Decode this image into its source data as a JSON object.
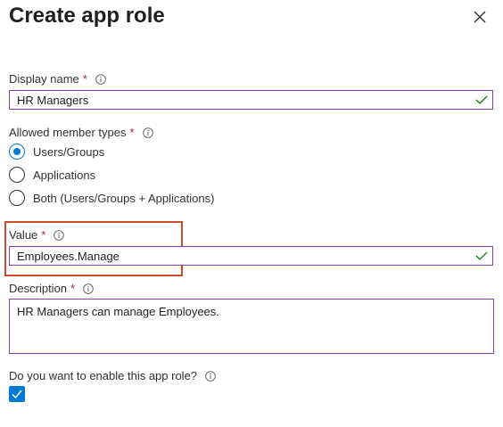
{
  "header": {
    "title": "Create app role"
  },
  "display_name": {
    "label": "Display name",
    "required_mark": "*",
    "value": "HR Managers"
  },
  "member_types": {
    "label": "Allowed member types",
    "required_mark": "*",
    "options": [
      "Users/Groups",
      "Applications",
      "Both (Users/Groups + Applications)"
    ],
    "selected": "Users/Groups"
  },
  "value_field": {
    "label": "Value",
    "required_mark": "*",
    "value": "Employees.Manage"
  },
  "description": {
    "label": "Description",
    "required_mark": "*",
    "value": "HR Managers can manage Employees."
  },
  "enable": {
    "label": "Do you want to enable this app role?",
    "checked": true
  },
  "colors": {
    "accent": "#0078d4",
    "field_border": "#8a3fa8",
    "valid_check": "#107c10",
    "required": "#a4262c",
    "highlight": "#d24a2a"
  },
  "icons": [
    "close-icon",
    "info-icon",
    "checkmark-icon"
  ]
}
